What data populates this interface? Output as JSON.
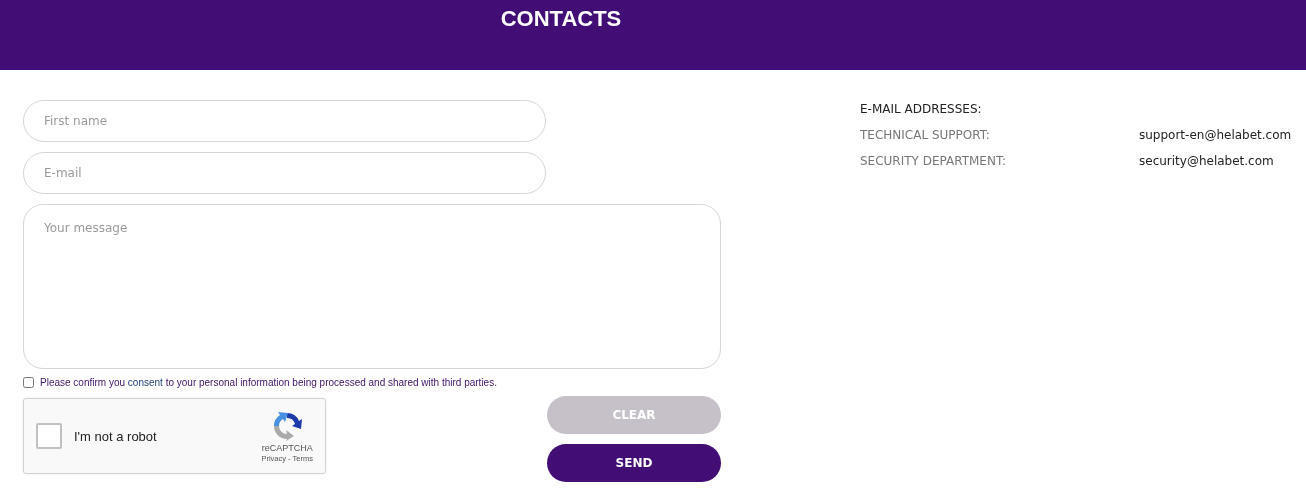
{
  "header": {
    "title": "CONTACTS"
  },
  "form": {
    "first_name": {
      "placeholder": "First name"
    },
    "email": {
      "placeholder": "E-mail"
    },
    "message": {
      "placeholder": "Your message"
    },
    "consent": {
      "checked": false,
      "text_before": "Please confirm you",
      "link": "consent",
      "text_after": "to your personal information being processed and shared with third parties."
    },
    "captcha": {
      "checked": false,
      "label": "I'm not a robot",
      "brand": "reCAPTCHA",
      "links": "Privacy - Terms"
    },
    "buttons": [
      {
        "label": "CLEAR",
        "disabled": true
      },
      {
        "label": "SEND",
        "disabled": false
      }
    ]
  },
  "contacts": {
    "heading": "E-MAIL ADDRESSES:",
    "rows": [
      {
        "label": "TECHNICAL SUPPORT:",
        "value": "support-en@helabet.com"
      },
      {
        "label": "SECURITY DEPARTMENT:",
        "value": "security@helabet.com"
      }
    ]
  }
}
